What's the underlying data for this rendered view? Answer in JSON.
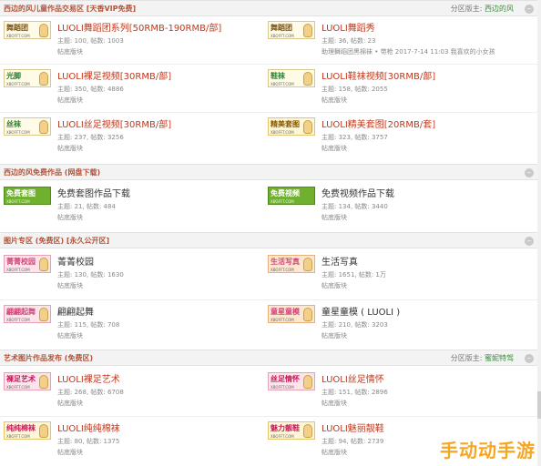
{
  "sections": [
    {
      "title": "西边的风儿童作品交易区 [天香VIP免费]",
      "moderator_label": "分区版主: ",
      "moderator_name": "西边的风",
      "forums": [
        {
          "logo": "舞蹈团",
          "title": "LUOLI舞蹈团系列[50RMB-190RMB/部]",
          "stats": "主题: 100, 帖数: 1003",
          "mod": "帖底版块"
        },
        {
          "logo": "舞蹈团",
          "title": "LUOLI舞蹈秀",
          "stats": "主题: 36, 帖数: 23",
          "extra": "助理舞蹈团黑棉袜 • 带枪  2017-7-14 11:03  我喜欢的小女孩",
          "mod": ""
        },
        {
          "logo": "光脚",
          "title": "LUOLI裸足视频[30RMB/部]",
          "stats": "主题: 350, 帖数: 4886",
          "mod": "帖底版块"
        },
        {
          "logo": "鞋袜",
          "title": "LUOLI鞋袜视频[30RMB/部]",
          "stats": "主题: 158, 帖数: 2055",
          "mod": "帖底版块"
        },
        {
          "logo": "丝袜",
          "title": "LUOLI丝足视频[30RMB/部]",
          "stats": "主题: 237, 帖数: 3256",
          "mod": "帖底版块"
        },
        {
          "logo": "精美套图",
          "title": "LUOLI精美套图[20RMB/套]",
          "stats": "主题: 323, 帖数: 3757",
          "mod": "帖底版块"
        }
      ]
    },
    {
      "title": "西边的风免费作品 (网盘下载)",
      "forums": [
        {
          "logo": "免费套图",
          "title": "免费套图作品下载",
          "stats": "主题: 21, 帖数: 484",
          "mod": "帖底版块"
        },
        {
          "logo": "免费视频",
          "title": "免费视频作品下载",
          "stats": "主题: 134, 帖数: 3440",
          "mod": "帖底版块"
        }
      ]
    },
    {
      "title": "图片专区 (免费区) [永久公开区]",
      "forums": [
        {
          "logo": "菁菁校园",
          "title": "菁菁校园",
          "stats": "主题: 130, 帖数: 1630",
          "mod": "帖底版块"
        },
        {
          "logo": "生活写真",
          "title": "生活写真",
          "stats": "主题: 1651, 帖数: 1万",
          "mod": "帖底版块"
        },
        {
          "logo": "翩翩起舞",
          "title": "翩翩起舞",
          "stats": "主题: 115, 帖数: 708",
          "mod": "帖底版块"
        },
        {
          "logo": "童星童模",
          "title": "童星童模 ( LUOLI )",
          "stats": "主题: 210, 帖数: 3203",
          "mod": "帖底版块"
        }
      ]
    },
    {
      "title": "艺术图片作品发布 (免费区)",
      "moderator_label": "分区版主: ",
      "moderator_name": "蜜妮特驾",
      "forums": [
        {
          "logo": "裸足艺术",
          "title": "LUOLI裸足艺术",
          "stats": "主题: 268, 帖数: 6708",
          "mod": "帖底版块"
        },
        {
          "logo": "丝足情怀",
          "title": "LUOLI丝足情怀",
          "stats": "主题: 151, 帖数: 2896",
          "mod": "帖底版块"
        },
        {
          "logo": "纯纯棉袜",
          "title": "LUOLI纯纯棉袜",
          "stats": "主题: 80, 帖数: 1375",
          "mod": "帖底版块"
        },
        {
          "logo": "魅力靓鞋",
          "title": "LUOLI魅丽靓鞋",
          "stats": "主题: 94, 帖数: 2739",
          "mod": "帖底版块"
        }
      ]
    }
  ],
  "logo_site": "XBOFFT.COM",
  "collapse_glyph": "−",
  "watermark": "手动动手游"
}
